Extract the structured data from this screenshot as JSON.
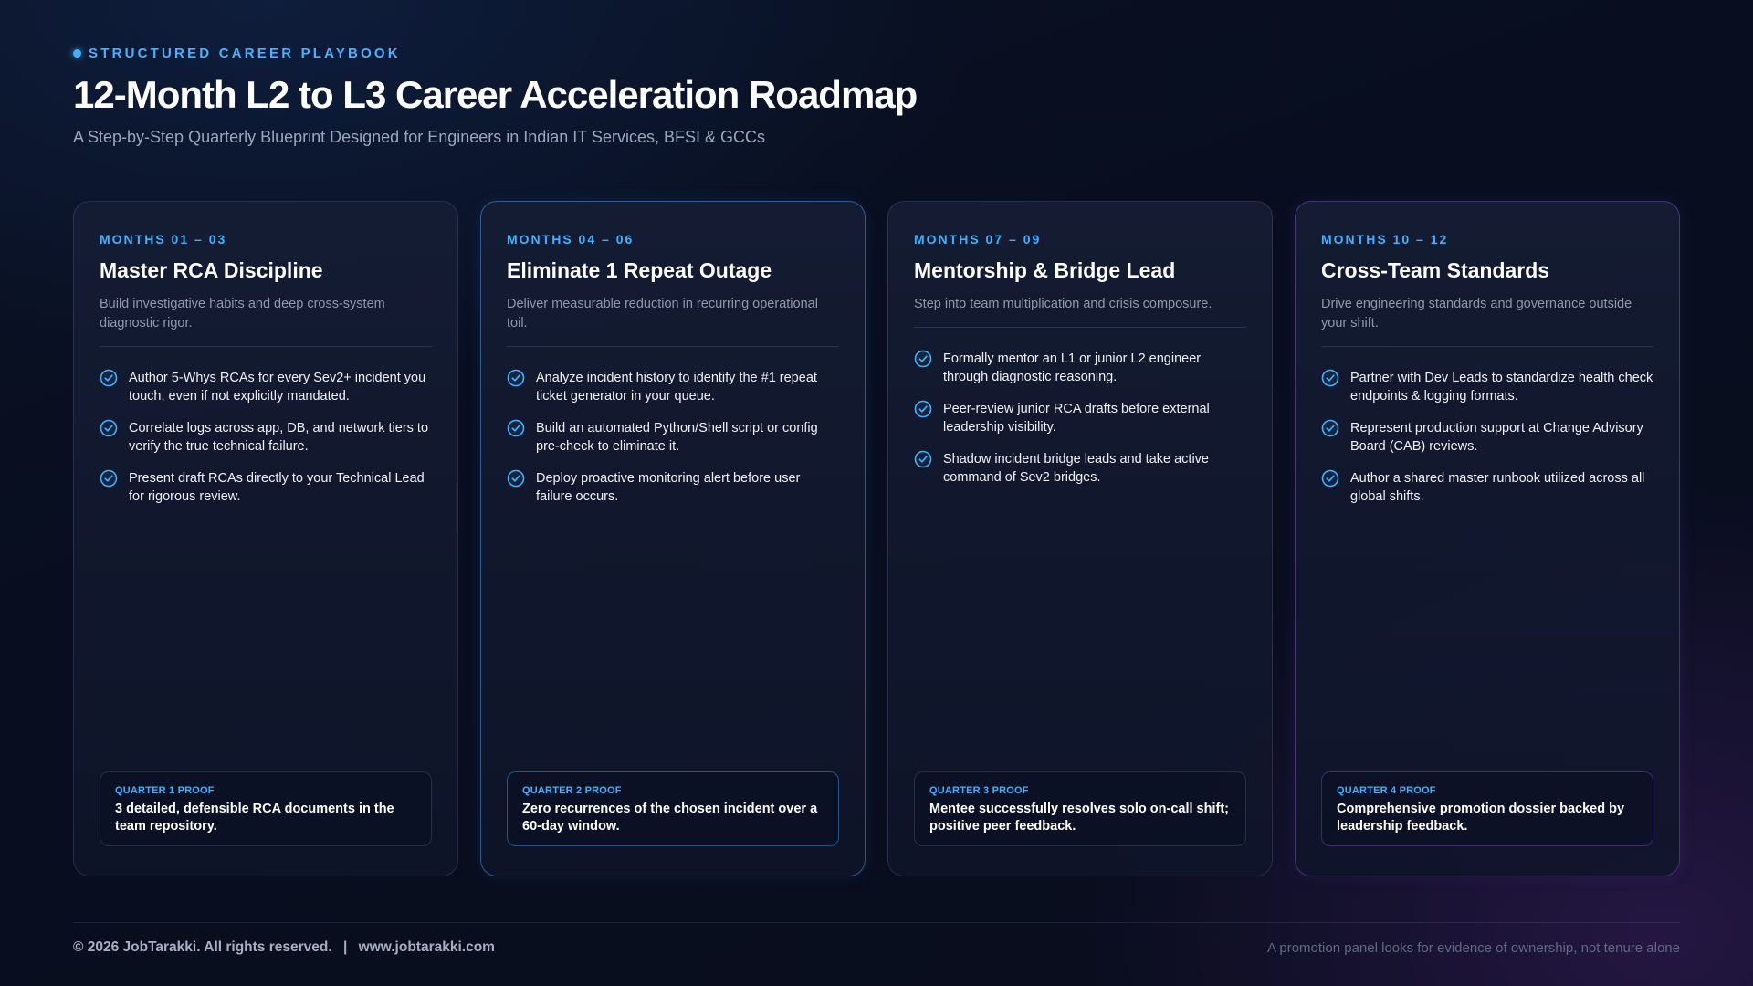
{
  "header": {
    "eyebrow": "STRUCTURED CAREER PLAYBOOK",
    "title": "12-Month L2 to L3 Career Acceleration Roadmap",
    "subtitle": "A Step-by-Step Quarterly Blueprint Designed for Engineers in Indian IT Services, BFSI & GCCs"
  },
  "icons": {
    "check": "check-circle-icon",
    "eyebrow_dot": "dot-icon"
  },
  "colors": {
    "accent": "#3fb2ff",
    "highlight_border_blue": "#4896e6",
    "highlight_border_purple": "#7850c8"
  },
  "cards": [
    {
      "months": "MONTHS 01 – 03",
      "title": "Master RCA Discipline",
      "description": "Build investigative habits and deep cross-system diagnostic rigor.",
      "items": [
        "Author 5-Whys RCAs for every Sev2+ incident you touch, even if not explicitly mandated.",
        "Correlate logs across app, DB, and network tiers to verify the true technical failure.",
        "Present draft RCAs directly to your Technical Lead for rigorous review."
      ],
      "proof_label": "QUARTER 1 PROOF",
      "proof_text": "3 detailed, defensible RCA documents in the team repository."
    },
    {
      "months": "MONTHS 04 – 06",
      "title": "Eliminate 1 Repeat Outage",
      "description": "Deliver measurable reduction in recurring operational toil.",
      "items": [
        "Analyze incident history to identify the #1 repeat ticket generator in your queue.",
        "Build an automated Python/Shell script or config pre-check to eliminate it.",
        "Deploy proactive monitoring alert before user failure occurs."
      ],
      "proof_label": "QUARTER 2 PROOF",
      "proof_text": "Zero recurrences of the chosen incident over a 60-day window."
    },
    {
      "months": "MONTHS 07 – 09",
      "title": "Mentorship & Bridge Lead",
      "description": "Step into team multiplication and crisis composure.",
      "items": [
        "Formally mentor an L1 or junior L2 engineer through diagnostic reasoning.",
        "Peer-review junior RCA drafts before external leadership visibility.",
        "Shadow incident bridge leads and take active command of Sev2 bridges."
      ],
      "proof_label": "QUARTER 3 PROOF",
      "proof_text": "Mentee successfully resolves solo on-call shift; positive peer feedback."
    },
    {
      "months": "MONTHS 10 – 12",
      "title": "Cross-Team Standards",
      "description": "Drive engineering standards and governance outside your shift.",
      "items": [
        "Partner with Dev Leads to standardize health check endpoints & logging formats.",
        "Represent production support at Change Advisory Board (CAB) reviews.",
        "Author a shared master runbook utilized across all global shifts."
      ],
      "proof_label": "QUARTER 4 PROOF",
      "proof_text": "Comprehensive promotion dossier backed by leadership feedback."
    }
  ],
  "footer": {
    "copyright": "© 2026 JobTarakki. All rights reserved.",
    "separator": "|",
    "website": "www.jobtarakki.com",
    "tagline": "A promotion panel looks for evidence of ownership, not tenure alone"
  }
}
